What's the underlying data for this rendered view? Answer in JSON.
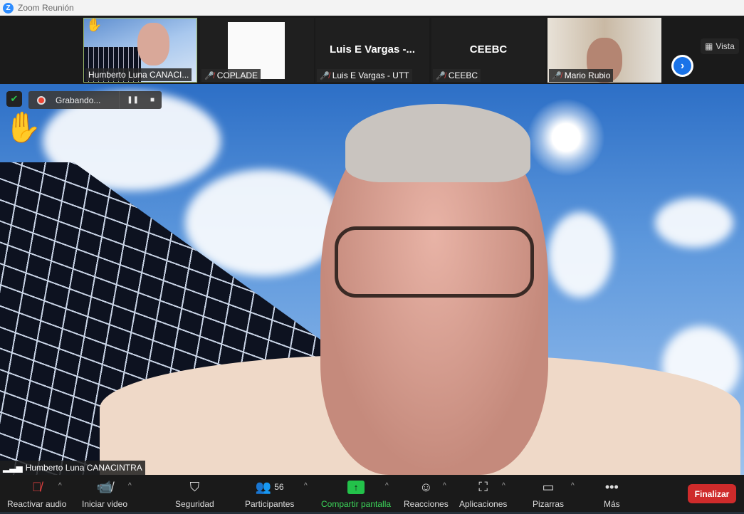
{
  "window": {
    "title": "Zoom Reunión",
    "logo": "Z"
  },
  "strip": {
    "tiles": [
      {
        "name": "Humberto Luna CANACI...",
        "muted": false,
        "hand_raised": true
      },
      {
        "name": "COPLADE",
        "muted": true
      },
      {
        "name": "Luis E Vargas - UTT",
        "display": "Luis E Vargas -...",
        "muted": true
      },
      {
        "name": "CEEBC",
        "display": "CEEBC",
        "muted": true
      },
      {
        "name": "Mario Rubio",
        "muted": true
      }
    ],
    "view_label": "Vista"
  },
  "main": {
    "speaker": "Humberto Luna CANACINTRA",
    "recording_label": "Grabando..."
  },
  "toolbar": {
    "audio": "Reactivar audio",
    "video": "Iniciar video",
    "security": "Seguridad",
    "participants": "Participantes",
    "participants_count": "56",
    "share": "Compartir pantalla",
    "reactions": "Reacciones",
    "apps": "Aplicaciones",
    "whiteboards": "Pizarras",
    "more": "Más",
    "end": "Finalizar"
  },
  "colors": {
    "share": "#23c24a",
    "end": "#cf2b2b",
    "accent": "#1a73e8"
  }
}
